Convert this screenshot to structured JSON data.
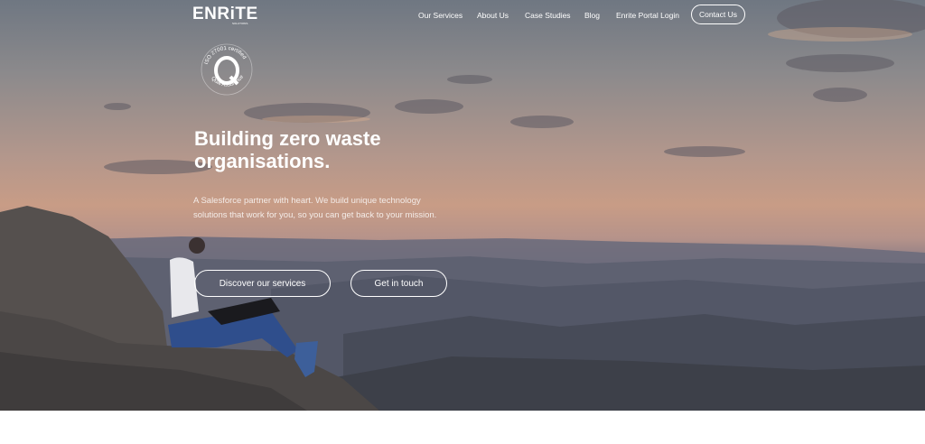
{
  "nav": {
    "logo": "ENRiTE",
    "logo_sub": "SOLUTIONS",
    "links": [
      "Our Services",
      "About Us",
      "Case Studies",
      "Blog",
      "Enrite Portal Login"
    ],
    "contact": "Contact Us"
  },
  "badge": {
    "top": "ISO 27001 certified",
    "bottom": "Qual Assurance",
    "icon": "certification-seal-icon"
  },
  "hero": {
    "headline_1": "Building zero waste",
    "headline_2": "organisations.",
    "subtext": "A Salesforce partner with heart. We build unique technology solutions that work for you, so you can get back to your mission.",
    "cta_primary": "Discover our services",
    "cta_secondary": "Get in touch"
  }
}
